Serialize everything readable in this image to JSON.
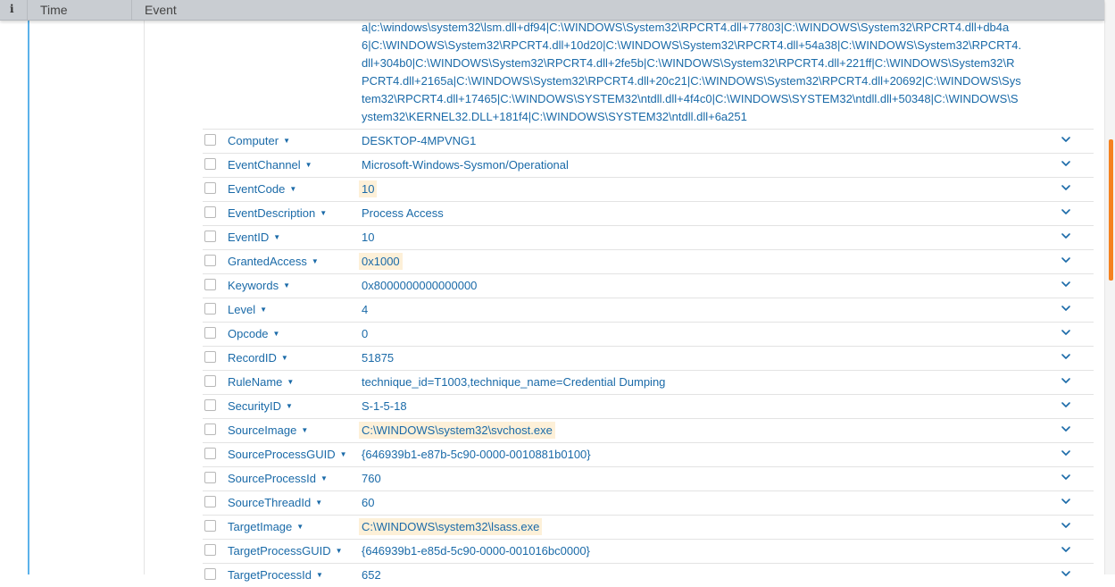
{
  "header": {
    "info_icon": "i",
    "col_time": "Time",
    "col_event": "Event"
  },
  "message_lines": [
    "a|c:\\windows\\system32\\lsm.dll+df94|C:\\WINDOWS\\System32\\RPCRT4.dll+77803|C:\\WINDOWS\\System32\\RPCRT4.dll+db4a",
    "6|C:\\WINDOWS\\System32\\RPCRT4.dll+10d20|C:\\WINDOWS\\System32\\RPCRT4.dll+54a38|C:\\WINDOWS\\System32\\RPCRT4.",
    "dll+304b0|C:\\WINDOWS\\System32\\RPCRT4.dll+2fe5b|C:\\WINDOWS\\System32\\RPCRT4.dll+221ff|C:\\WINDOWS\\System32\\R",
    "PCRT4.dll+2165a|C:\\WINDOWS\\System32\\RPCRT4.dll+20c21|C:\\WINDOWS\\System32\\RPCRT4.dll+20692|C:\\WINDOWS\\Sys",
    "tem32\\RPCRT4.dll+17465|C:\\WINDOWS\\SYSTEM32\\ntdll.dll+4f4c0|C:\\WINDOWS\\SYSTEM32\\ntdll.dll+50348|C:\\WINDOWS\\S",
    "ystem32\\KERNEL32.DLL+181f4|C:\\WINDOWS\\SYSTEM32\\ntdll.dll+6a251"
  ],
  "fields": [
    {
      "name": "Computer",
      "value": "DESKTOP-4MPVNG1",
      "highlight": false
    },
    {
      "name": "EventChannel",
      "value": "Microsoft-Windows-Sysmon/Operational",
      "highlight": false
    },
    {
      "name": "EventCode",
      "value": "10",
      "highlight": true
    },
    {
      "name": "EventDescription",
      "value": "Process Access",
      "highlight": false
    },
    {
      "name": "EventID",
      "value": "10",
      "highlight": false
    },
    {
      "name": "GrantedAccess",
      "value": "0x1000",
      "highlight": true
    },
    {
      "name": "Keywords",
      "value": "0x8000000000000000",
      "highlight": false
    },
    {
      "name": "Level",
      "value": "4",
      "highlight": false
    },
    {
      "name": "Opcode",
      "value": "0",
      "highlight": false
    },
    {
      "name": "RecordID",
      "value": "51875",
      "highlight": false
    },
    {
      "name": "RuleName",
      "value": "technique_id=T1003,technique_name=Credential Dumping",
      "highlight": false
    },
    {
      "name": "SecurityID",
      "value": "S-1-5-18",
      "highlight": false
    },
    {
      "name": "SourceImage",
      "value": "C:\\WINDOWS\\system32\\svchost.exe",
      "highlight": true
    },
    {
      "name": "SourceProcessGUID",
      "value": "{646939b1-e87b-5c90-0000-0010881b0100}",
      "highlight": false
    },
    {
      "name": "SourceProcessId",
      "value": "760",
      "highlight": false
    },
    {
      "name": "SourceThreadId",
      "value": "60",
      "highlight": false
    },
    {
      "name": "TargetImage",
      "value": "C:\\WINDOWS\\system32\\lsass.exe",
      "highlight": true
    },
    {
      "name": "TargetProcessGUID",
      "value": "{646939b1-e85d-5c90-0000-001016bc0000}",
      "highlight": false
    },
    {
      "name": "TargetProcessId",
      "value": "652",
      "highlight": false
    }
  ],
  "icons": {
    "caret": "caret-down-icon",
    "expand": "chevron-down-icon",
    "checkbox": "checkbox"
  },
  "colors": {
    "link": "#1a6aa8",
    "highlight_bg": "#fdf0d8",
    "gutter_accent": "#5cb2ea",
    "scrollbar_thumb": "#f58220",
    "header_bg": "#c9cdd2"
  }
}
